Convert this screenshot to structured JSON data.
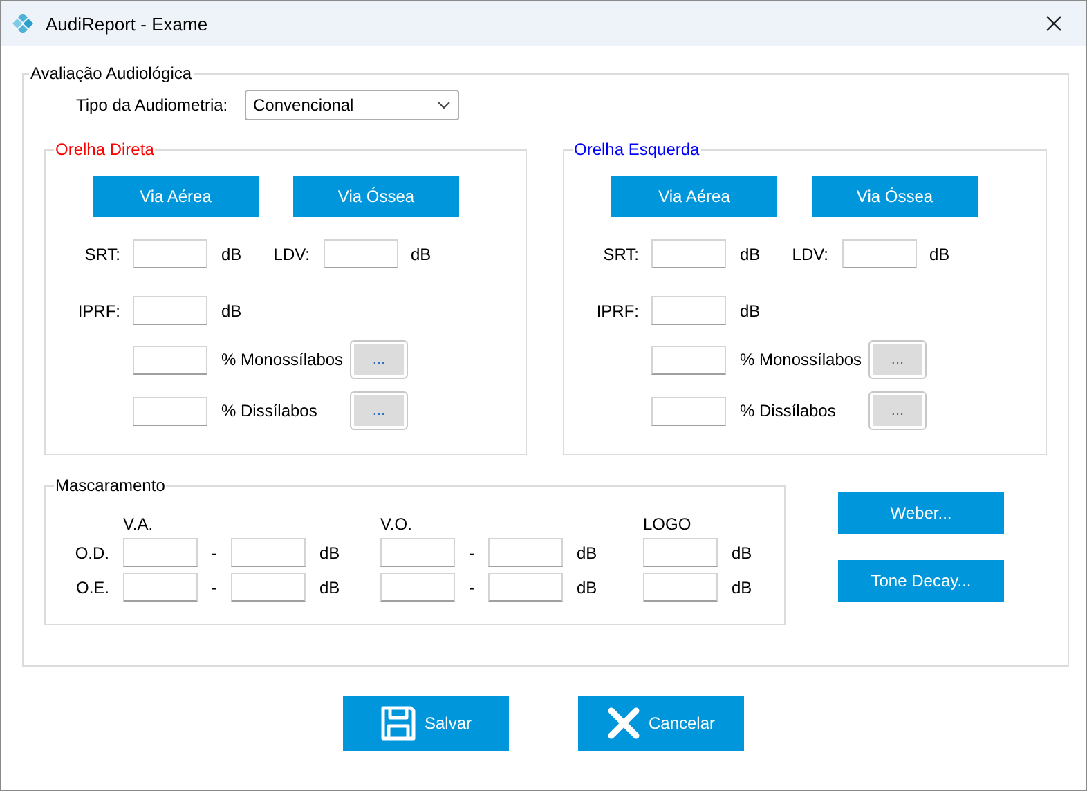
{
  "window": {
    "title": "AudiReport - Exame"
  },
  "evaluation": {
    "legend": "Avaliação Audiológica",
    "type_label": "Tipo da Audiometria:",
    "type_value": "Convencional"
  },
  "ears": [
    {
      "legend": "Orelha Direta",
      "color": "#ff0000",
      "buttons": [
        "Via Aérea",
        "Via Óssea"
      ],
      "rows": [
        {
          "kind": "pair",
          "label": "SRT:",
          "unit": "dB",
          "label2": "LDV:",
          "unit2": "dB"
        },
        {
          "kind": "single",
          "label": "IPRF:",
          "unit": "dB"
        },
        {
          "kind": "percent",
          "unit": "% Monossílabos",
          "more": "..."
        },
        {
          "kind": "percent",
          "unit": "% Dissílabos",
          "more": "..."
        }
      ]
    },
    {
      "legend": "Orelha Esquerda",
      "color": "#0000ff",
      "buttons": [
        "Via Aérea",
        "Via Óssea"
      ],
      "rows": [
        {
          "kind": "pair",
          "label": "SRT:",
          "unit": "dB",
          "label2": "LDV:",
          "unit2": "dB"
        },
        {
          "kind": "single",
          "label": "IPRF:",
          "unit": "dB"
        },
        {
          "kind": "percent",
          "unit": "% Monossílabos",
          "more": "..."
        },
        {
          "kind": "percent",
          "unit": "% Dissílabos",
          "more": "..."
        }
      ]
    }
  ],
  "masking": {
    "legend": "Mascaramento",
    "headings": [
      {
        "kind": "range",
        "text": "V.A."
      },
      {
        "kind": "range",
        "text": "V.O."
      },
      {
        "kind": "single",
        "text": "LOGO"
      }
    ],
    "rows": [
      {
        "label": "O.D.",
        "cells": [
          {
            "kind": "range",
            "dash": "-",
            "unit": "dB"
          },
          {
            "kind": "range",
            "dash": "-",
            "unit": "dB"
          },
          {
            "kind": "single",
            "unit": "dB"
          }
        ]
      },
      {
        "label": "O.E.",
        "cells": [
          {
            "kind": "range",
            "dash": "-",
            "unit": "dB"
          },
          {
            "kind": "range",
            "dash": "-",
            "unit": "dB"
          },
          {
            "kind": "single",
            "unit": "dB"
          }
        ]
      }
    ]
  },
  "side_buttons": [
    "Weber...",
    "Tone Decay..."
  ],
  "footer_buttons": [
    {
      "kind": "save",
      "label": "Salvar"
    },
    {
      "kind": "cancel",
      "label": "Cancelar"
    }
  ]
}
